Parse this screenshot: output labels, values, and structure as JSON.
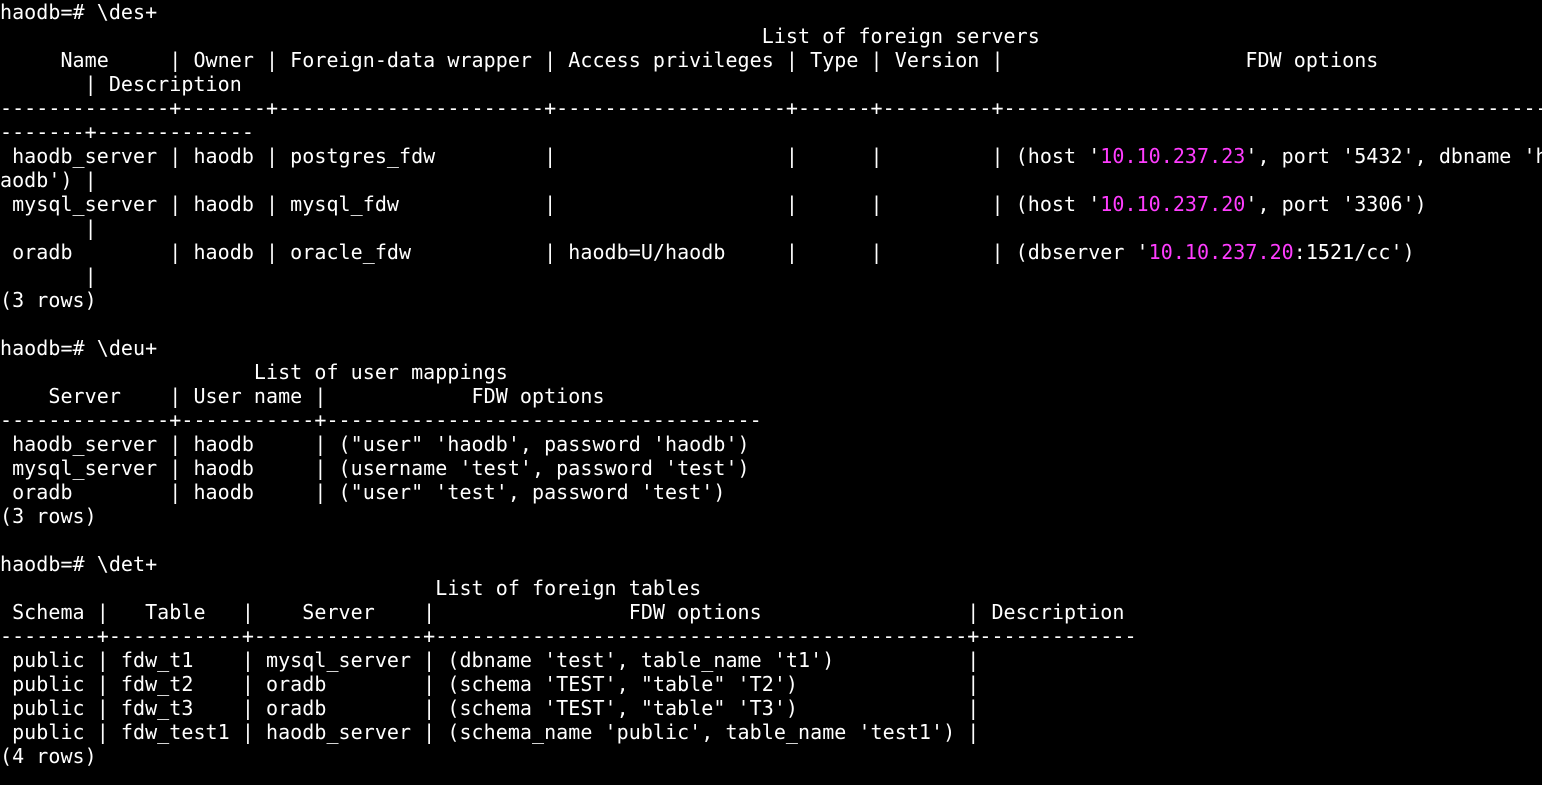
{
  "colors": {
    "background": "#000000",
    "foreground": "#ffffff",
    "ip_highlight": "#ff3dff"
  },
  "lines": [
    [
      {
        "t": "haodb=# \\des+"
      }
    ],
    [
      {
        "t": "                                                               List of foreign servers"
      }
    ],
    [
      {
        "t": "     Name     | Owner | Foreign-data wrapper | Access privileges | Type | Version |                    FDW options"
      }
    ],
    [
      {
        "t": "       | Description"
      }
    ],
    [
      {
        "t": "--------------+-------+----------------------+-------------------+------+---------+--------------------------------------------------------"
      }
    ],
    [
      {
        "t": "-------+-------------"
      }
    ],
    [
      {
        "t": " haodb_server | haodb | postgres_fdw         |                   |      |         | (host '"
      },
      {
        "t": "10.10.237.23",
        "h": 1
      },
      {
        "t": "', port '5432', dbname 'h"
      }
    ],
    [
      {
        "t": "aodb') |"
      }
    ],
    [
      {
        "t": " mysql_server | haodb | mysql_fdw            |                   |      |         | (host '"
      },
      {
        "t": "10.10.237.20",
        "h": 1
      },
      {
        "t": "', port '3306')"
      }
    ],
    [
      {
        "t": "       |"
      }
    ],
    [
      {
        "t": " oradb        | haodb | oracle_fdw           | haodb=U/haodb     |      |         | (dbserver '"
      },
      {
        "t": "10.10.237.20",
        "h": 1
      },
      {
        "t": ":1521/cc')"
      }
    ],
    [
      {
        "t": "       |"
      }
    ],
    [
      {
        "t": "(3 rows)"
      }
    ],
    [
      {
        "t": ""
      }
    ],
    [
      {
        "t": "haodb=# \\deu+"
      }
    ],
    [
      {
        "t": "                     List of user mappings"
      }
    ],
    [
      {
        "t": "    Server    | User name |            FDW options"
      }
    ],
    [
      {
        "t": "--------------+-----------+------------------------------------"
      }
    ],
    [
      {
        "t": " haodb_server | haodb     | (\"user\" 'haodb', password 'haodb')"
      }
    ],
    [
      {
        "t": " mysql_server | haodb     | (username 'test', password 'test')"
      }
    ],
    [
      {
        "t": " oradb        | haodb     | (\"user\" 'test', password 'test')"
      }
    ],
    [
      {
        "t": "(3 rows)"
      }
    ],
    [
      {
        "t": ""
      }
    ],
    [
      {
        "t": "haodb=# \\det+"
      }
    ],
    [
      {
        "t": "                                    List of foreign tables"
      }
    ],
    [
      {
        "t": " Schema |   Table   |    Server    |                FDW options                 | Description"
      }
    ],
    [
      {
        "t": "--------+-----------+--------------+--------------------------------------------+-------------"
      }
    ],
    [
      {
        "t": " public | fdw_t1    | mysql_server | (dbname 'test', table_name 't1')           |"
      }
    ],
    [
      {
        "t": " public | fdw_t2    | oradb        | (schema 'TEST', \"table\" 'T2')              |"
      }
    ],
    [
      {
        "t": " public | fdw_t3    | oradb        | (schema 'TEST', \"table\" 'T3')              |"
      }
    ],
    [
      {
        "t": " public | fdw_test1 | haodb_server | (schema_name 'public', table_name 'test1') |"
      }
    ],
    [
      {
        "t": "(4 rows)"
      }
    ]
  ]
}
